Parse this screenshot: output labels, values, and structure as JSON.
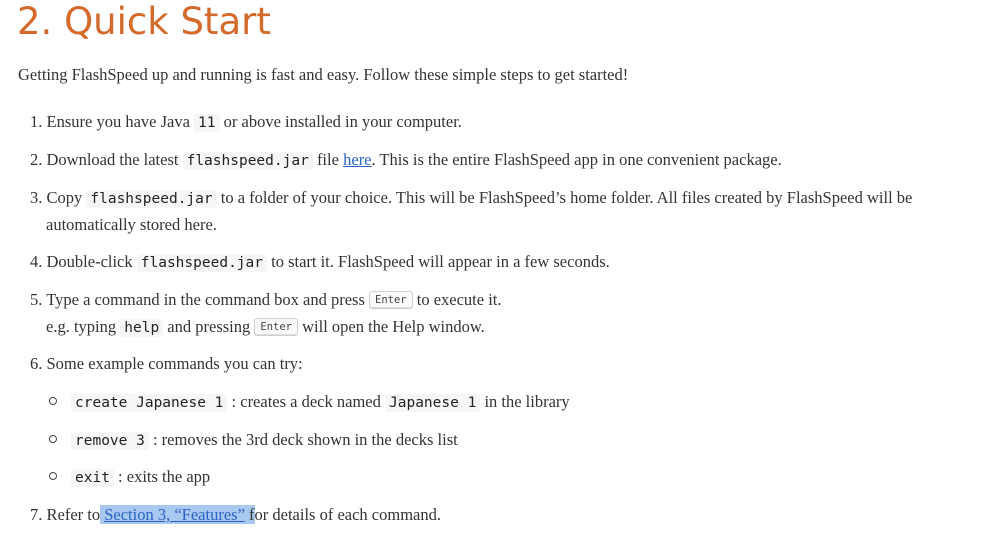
{
  "heading": "2. Quick Start",
  "intro": "Getting FlashSpeed up and running is fast and easy. Follow these simple steps to get started!",
  "steps": {
    "s1": {
      "num": "1.",
      "pre": "Ensure you have Java",
      "code": "11",
      "post": "or above installed in your computer."
    },
    "s2": {
      "num": "2.",
      "pre": "Download the latest",
      "code": "flashspeed.jar",
      "mid": "file",
      "link": "here",
      "post": ". This is the entire FlashSpeed app in one convenient package."
    },
    "s3": {
      "num": "3.",
      "pre": "Copy",
      "code": "flashspeed.jar",
      "post": "to a folder of your choice. This will be FlashSpeed’s home folder. All files created by FlashSpeed will be",
      "cont": "automatically stored here."
    },
    "s4": {
      "num": "4.",
      "pre": "Double-click",
      "code": "flashspeed.jar",
      "post": "to start it. FlashSpeed will appear in a few seconds."
    },
    "s5": {
      "num": "5.",
      "pre": "Type a command in the command box and press",
      "key": "Enter",
      "post": "to execute it.",
      "l2_pre": "e.g. typing",
      "l2_code": "help",
      "l2_mid": "and pressing",
      "l2_key": "Enter",
      "l2_post": "will open the Help window."
    },
    "s6": {
      "num": "6.",
      "text": "Some example commands you can try:"
    },
    "s7": {
      "num": "7.",
      "pre": "Refer to",
      "link": "Section 3, “Features”",
      "post": "for details of each command."
    }
  },
  "examples": [
    {
      "code": "create Japanese 1",
      "mid": ": creates a deck named",
      "code2": "Japanese 1",
      "post": "in the library"
    },
    {
      "code": "remove 3",
      "post": ": removes the 3rd deck shown in the decks list"
    },
    {
      "code": "exit",
      "post": ": exits the app"
    }
  ]
}
